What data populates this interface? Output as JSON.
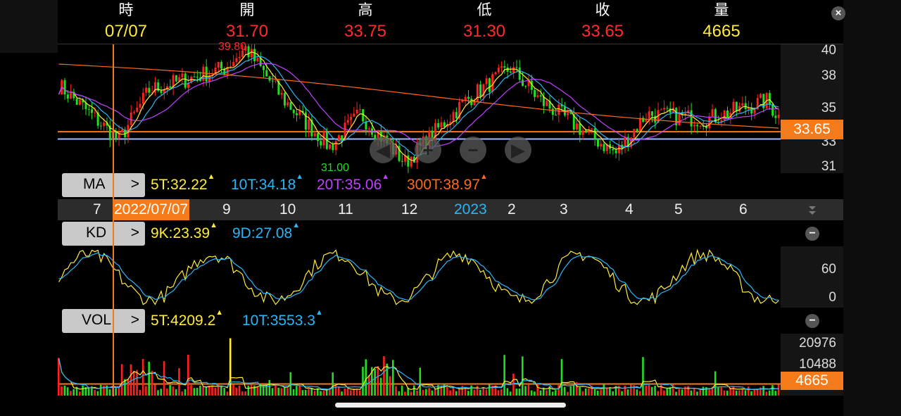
{
  "header": {
    "fields": [
      {
        "label": "時",
        "value": "07/07",
        "color": "#ffeb3b"
      },
      {
        "label": "開",
        "value": "31.70",
        "color": "#ff2a2a"
      },
      {
        "label": "高",
        "value": "33.75",
        "color": "#ff2a2a"
      },
      {
        "label": "低",
        "value": "31.30",
        "color": "#ff2a2a"
      },
      {
        "label": "收",
        "value": "33.65",
        "color": "#ff2a2a"
      },
      {
        "label": "量",
        "value": "4665",
        "color": "#ffeb3b"
      }
    ],
    "close_symbol": "×"
  },
  "price_chart": {
    "y_labels": [
      "40",
      "38",
      "35",
      "33",
      "31"
    ],
    "current_price": "33.65",
    "high_annotation": "39.80",
    "low_annotation": "31.00"
  },
  "ma_panel": {
    "button_label": "MA",
    "chevron": ">",
    "legend": [
      {
        "text": "5T:32.22",
        "color": "#ffeb3b"
      },
      {
        "text": "10T:34.18",
        "color": "#29b6f6"
      },
      {
        "text": "20T:35.06",
        "color": "#c040ff"
      },
      {
        "text": "300T:38.97",
        "color": "#ff6a1a"
      }
    ]
  },
  "time_axis": {
    "labels": [
      "7",
      "2022/07/07",
      "9",
      "10",
      "11",
      "12",
      "2023",
      "2",
      "3",
      "4",
      "5",
      "6"
    ],
    "cursor_label_color": "#f47a1a",
    "year_color": "#29b6f6"
  },
  "kd_panel": {
    "button_label": "KD",
    "chevron": ">",
    "legend": [
      {
        "text": "9K:23.39",
        "color": "#ffeb3b"
      },
      {
        "text": "9D:27.08",
        "color": "#29b6f6"
      }
    ],
    "y_labels": [
      "60",
      "0"
    ],
    "minus_symbol": "−"
  },
  "vol_panel": {
    "button_label": "VOL",
    "chevron": ">",
    "legend": [
      {
        "text": "5T:4209.2",
        "color": "#ffeb3b"
      },
      {
        "text": "10T:3553.3",
        "color": "#29b6f6"
      }
    ],
    "y_labels": [
      "20976",
      "10488"
    ],
    "current_volume": "4665",
    "minus_symbol": "−"
  },
  "nav_controls": {
    "prev": "◀",
    "zoom_in": "+",
    "zoom_out": "−",
    "next": "▶"
  },
  "colors": {
    "up": "#ff2020",
    "down": "#22dd22",
    "cursor": "#f47a1a",
    "ref_line": "#a0b8ff"
  }
}
